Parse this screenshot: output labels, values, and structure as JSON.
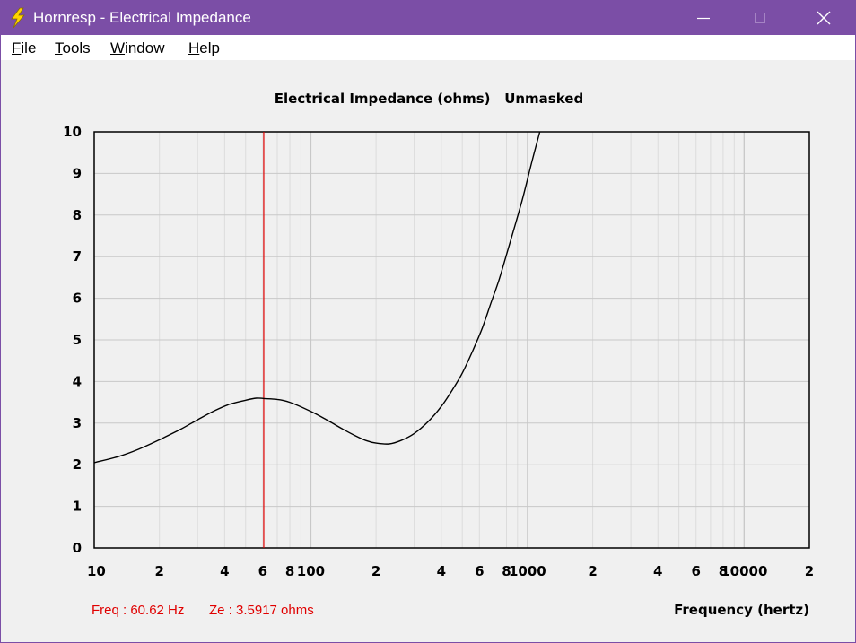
{
  "window": {
    "title": "Hornresp - Electrical Impedance",
    "controls": [
      "minimize",
      "maximize",
      "close"
    ]
  },
  "menu": {
    "items": [
      {
        "accel": "F",
        "rest": "ile"
      },
      {
        "accel": "T",
        "rest": "ools"
      },
      {
        "accel": "W",
        "rest": "indow"
      },
      {
        "accel": "H",
        "rest": "elp"
      }
    ]
  },
  "readout": {
    "freq": "Freq : 60.62 Hz",
    "ze": "Ze : 3.5917 ohms"
  },
  "colors": {
    "titlebar": "#7b4ea6",
    "curve": "#000000",
    "cursor": "#e00000",
    "grid_major": "#c8c8c8",
    "grid_minor": "#dcdcdc"
  },
  "chart_data": {
    "type": "line",
    "title": "Electrical Impedance (ohms)   Unmasked",
    "xlabel": "Frequency (hertz)",
    "ylabel": "",
    "x_scale": "log",
    "xlim": [
      10,
      20000
    ],
    "ylim": [
      0,
      10
    ],
    "grid": true,
    "y_ticks": [
      "0",
      "1",
      "2",
      "3",
      "4",
      "5",
      "6",
      "7",
      "8",
      "9",
      "10"
    ],
    "x_ticks": [
      {
        "v": 10,
        "label": "10"
      },
      {
        "v": 20,
        "label": "2"
      },
      {
        "v": 40,
        "label": "4"
      },
      {
        "v": 60,
        "label": "6"
      },
      {
        "v": 80,
        "label": "8"
      },
      {
        "v": 100,
        "label": "100"
      },
      {
        "v": 200,
        "label": "2"
      },
      {
        "v": 400,
        "label": "4"
      },
      {
        "v": 600,
        "label": "6"
      },
      {
        "v": 800,
        "label": "8"
      },
      {
        "v": 1000,
        "label": "1000"
      },
      {
        "v": 2000,
        "label": "2"
      },
      {
        "v": 4000,
        "label": "4"
      },
      {
        "v": 6000,
        "label": "6"
      },
      {
        "v": 8000,
        "label": "8"
      },
      {
        "v": 10000,
        "label": "10000"
      },
      {
        "v": 20000,
        "label": "2"
      }
    ],
    "cursor_x": 60.62,
    "series": [
      {
        "points": [
          [
            10,
            2.05
          ],
          [
            13,
            2.2
          ],
          [
            16,
            2.37
          ],
          [
            20,
            2.6
          ],
          [
            25,
            2.85
          ],
          [
            30,
            3.08
          ],
          [
            36,
            3.3
          ],
          [
            42,
            3.45
          ],
          [
            50,
            3.55
          ],
          [
            56,
            3.6
          ],
          [
            60.62,
            3.59
          ],
          [
            70,
            3.57
          ],
          [
            80,
            3.5
          ],
          [
            100,
            3.28
          ],
          [
            120,
            3.06
          ],
          [
            140,
            2.86
          ],
          [
            160,
            2.7
          ],
          [
            180,
            2.58
          ],
          [
            200,
            2.52
          ],
          [
            230,
            2.5
          ],
          [
            260,
            2.58
          ],
          [
            300,
            2.75
          ],
          [
            350,
            3.05
          ],
          [
            400,
            3.4
          ],
          [
            450,
            3.8
          ],
          [
            500,
            4.2
          ],
          [
            560,
            4.75
          ],
          [
            620,
            5.3
          ],
          [
            680,
            5.9
          ],
          [
            740,
            6.45
          ],
          [
            800,
            7.05
          ],
          [
            870,
            7.7
          ],
          [
            950,
            8.4
          ],
          [
            1050,
            9.3
          ],
          [
            1140,
            10.0
          ]
        ]
      }
    ]
  }
}
